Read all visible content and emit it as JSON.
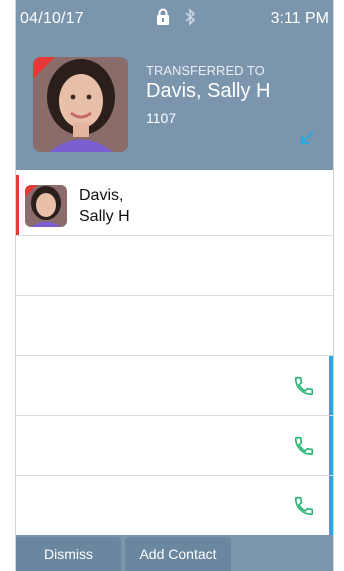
{
  "status": {
    "date": "04/10/17",
    "time": "3:11 PM",
    "icons": [
      "lock-icon",
      "bluetooth-icon"
    ]
  },
  "call": {
    "label": "TRANSFERRED TO",
    "name": "Davis, Sally H",
    "extension": "1107",
    "transfer_icon": "transfer-arrow-icon",
    "colors": {
      "header_bg": "#7b95ad",
      "alert_red": "#e53935",
      "accent_blue": "#2aa7dd"
    }
  },
  "list": {
    "rows": [
      {
        "name_line1": "Davis,",
        "name_line2": "Sally H"
      },
      {
        "empty": true
      },
      {
        "empty": true
      },
      {
        "icon": "phone-icon",
        "color": "#2bb673"
      },
      {
        "icon": "phone-icon",
        "color": "#2bb673"
      },
      {
        "icon": "phone-icon",
        "color": "#2bb673"
      }
    ]
  },
  "tabs": {
    "dismiss": "Dismiss",
    "add_contact": "Add Contact"
  }
}
